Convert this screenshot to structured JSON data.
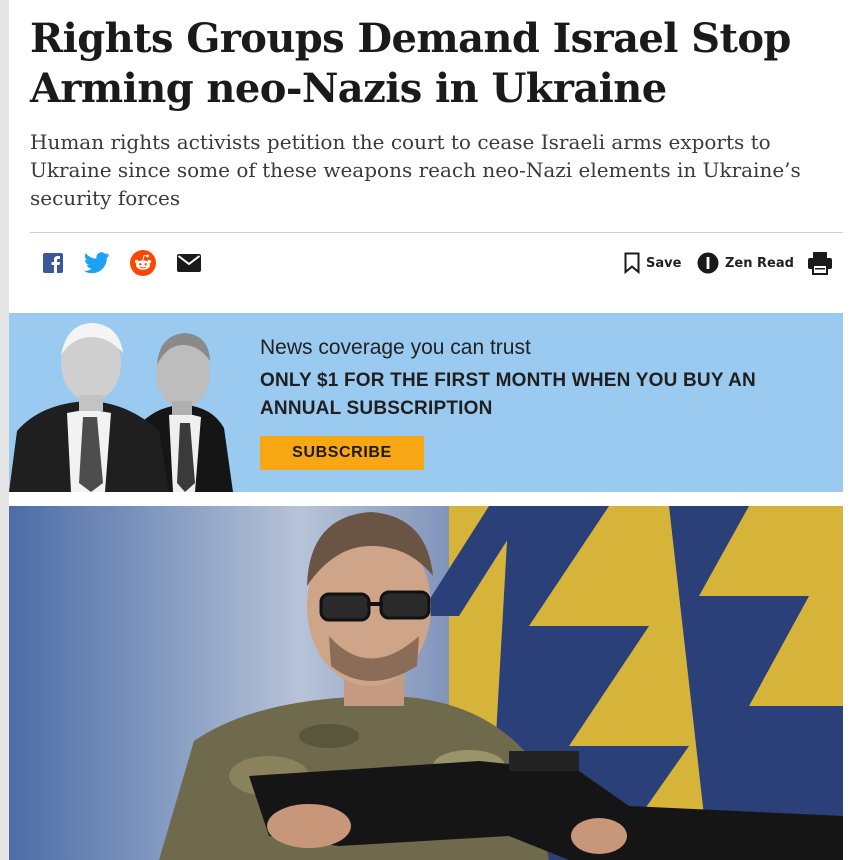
{
  "article": {
    "headline": "Rights Groups Demand Israel Stop Arming neo-Nazis in Ukraine",
    "subheadline": "Human rights activists petition the court to cease Israeli arms exports to Ukraine since some of these weapons reach neo-Nazi elements in Ukraine’s security forces"
  },
  "share": {
    "icons": [
      "facebook-icon",
      "twitter-icon",
      "reddit-icon",
      "email-icon"
    ],
    "save_label": "Save",
    "zen_label": "Zen Read",
    "print_icon": "print-icon"
  },
  "promo": {
    "line1": "News coverage you can trust",
    "line2": "ONLY $1 FOR THE FIRST MONTH WHEN YOU BUY AN ANNUAL SUBSCRIPTION",
    "button_label": "SUBSCRIBE",
    "background_color": "#9bcaf0",
    "button_color": "#f7a614"
  },
  "colors": {
    "facebook": "#3b5998",
    "twitter": "#1da1f2",
    "reddit": "#ff4500",
    "text": "#1a1a1a"
  }
}
